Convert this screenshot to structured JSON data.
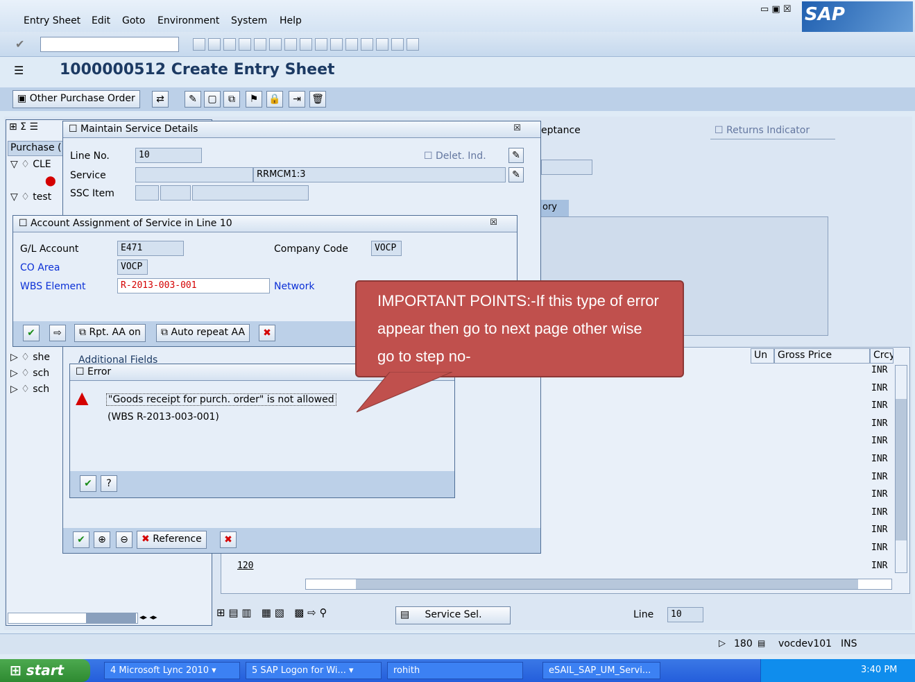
{
  "menu": {
    "items": [
      "Entry Sheet",
      "Edit",
      "Goto",
      "Environment",
      "System",
      "Help"
    ],
    "logo": "SAP"
  },
  "title": "1000000512 Create Entry Sheet",
  "apptoolbar": {
    "other_po": "Other Purchase Order"
  },
  "left": {
    "purchase_label": "Purchase (",
    "tree": [
      "CLE",
      "test",
      "she",
      "sch",
      "sch"
    ]
  },
  "bg": {
    "acceptance": "eptance",
    "returns": "Returns Indicator",
    "tab": "ory",
    "grid_headers": [
      "Un",
      "Gross Price",
      "Crcy"
    ],
    "line_num": "120",
    "crcy": [
      "INR",
      "INR",
      "INR",
      "INR",
      "INR",
      "INR",
      "INR",
      "INR",
      "INR",
      "INR",
      "INR",
      "INR"
    ],
    "service_sel": "Service Sel.",
    "line_label": "Line",
    "line_value": "10"
  },
  "maintain": {
    "title": "Maintain Service Details",
    "line_no_label": "Line No.",
    "line_no": "10",
    "delet_ind": "Delet. Ind.",
    "service_label": "Service",
    "service_value": "RRMCM1:3",
    "ssc_label": "SSC Item",
    "additional": "Additional Fields",
    "reference": "Reference"
  },
  "account": {
    "title": "Account Assignment of Service in Line 10",
    "gl_label": "G/L Account",
    "gl_value": "E471",
    "company_label": "Company Code",
    "company_value": "VOCP",
    "co_label": "CO Area",
    "co_value": "VOCP",
    "wbs_label": "WBS Element",
    "wbs_value": "R-2013-003-001",
    "network": "Network",
    "rpt": "Rpt. AA on",
    "auto": "Auto repeat AA"
  },
  "error": {
    "title": "Error",
    "line1": "\"Goods receipt for purch. order\" is not allowed",
    "line2": "(WBS R-2013-003-001)"
  },
  "callout": {
    "text": "IMPORTANT POINTS:-If this type of error appear then go to next page other wise go to step no-"
  },
  "status": {
    "num": "180",
    "server": "vocdev101",
    "mode": "INS"
  },
  "taskbar": {
    "start": "start",
    "tasks": [
      "4 Microsoft Lync 2010",
      "5 SAP Logon for Wi...",
      "rohith",
      "eSAIL_SAP_UM_Servi..."
    ],
    "time": "3:40 PM"
  },
  "colors": {
    "callout": "#c0504d",
    "sap_blue": "#1c3a63",
    "error_red": "#d40000"
  }
}
